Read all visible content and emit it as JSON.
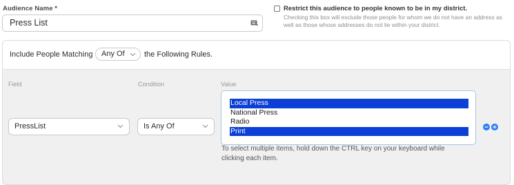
{
  "audience": {
    "name_label": "Audience Name *",
    "name_value": "Press List",
    "name_icon": "keyboard-icon"
  },
  "restrict": {
    "checked": false,
    "label": "Restrict this audience to people known to be in my district.",
    "help": "Checking this box will exclude those people for whom we do not have an address as well as those whose addresses do not lie within your district."
  },
  "match": {
    "prefix": "Include People Matching",
    "selected": "Any Of",
    "suffix": "the Following Rules."
  },
  "rule": {
    "headers": {
      "field": "Field",
      "condition": "Condition",
      "value": "Value"
    },
    "field_value": "PressList",
    "condition_value": "Is Any Of",
    "options": [
      {
        "label": "Local Press",
        "selected": true
      },
      {
        "label": "National Press",
        "selected": false
      },
      {
        "label": "Radio",
        "selected": false
      },
      {
        "label": "Print",
        "selected": true
      }
    ],
    "hint": "To select multiple items, hold down the CTRL key on your keyboard while clicking each item.",
    "accent_color": "#2f7df6",
    "selected_color": "#0b3fd6"
  }
}
